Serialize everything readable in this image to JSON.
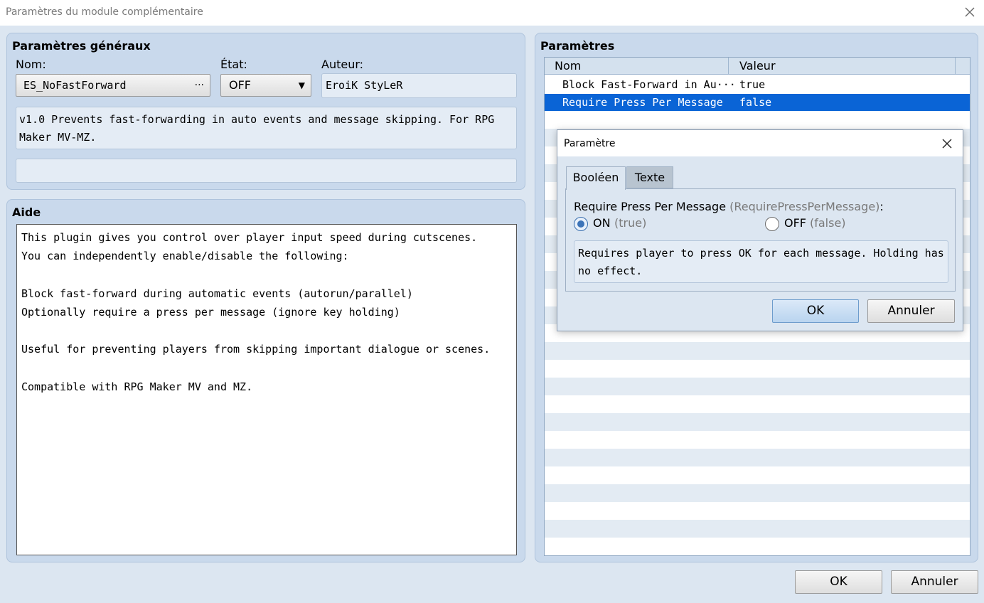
{
  "window": {
    "title": "Paramètres du module complémentaire"
  },
  "general": {
    "heading": "Paramètres généraux",
    "name_label": "Nom:",
    "name_value": "ES_NoFastForward",
    "name_button": "···",
    "state_label": "État:",
    "state_value": "OFF",
    "author_label": "Auteur:",
    "author_value": "EroiK StyLeR",
    "description_line1": "v1.0 Prevents fast-forwarding in auto events and message skipping. For RPG",
    "description_line2": "Maker MV-MZ.",
    "url_value": ""
  },
  "help": {
    "heading": "Aide",
    "lines": [
      "This plugin gives you control over player input speed during cutscenes.",
      "You can independently enable/disable the following:",
      "",
      "Block fast-forward during automatic events (autorun/parallel)",
      "Optionally require a press per message (ignore key holding)",
      "",
      "Useful for preventing players from skipping important dialogue or scenes.",
      "",
      "Compatible with RPG Maker MV and MZ."
    ]
  },
  "params": {
    "heading": "Paramètres",
    "col_name": "Nom",
    "col_value": "Valeur",
    "rows": [
      {
        "name": "Block Fast-Forward in Au···",
        "value": "true",
        "selected": false
      },
      {
        "name": "Require Press Per Message",
        "value": "false",
        "selected": true
      }
    ]
  },
  "dialog": {
    "title": "Paramètre",
    "tabs": [
      "Booléen",
      "Texte"
    ],
    "active_tab": "Booléen",
    "param_label": "Require Press Per Message",
    "param_key": "(RequirePressPerMessage)",
    "param_colon": ":",
    "on_label": "ON",
    "on_hint": "(true)",
    "off_label": "OFF",
    "off_hint": "(false)",
    "selected_option": "ON",
    "description_line1": "Requires player to press OK for each message. Holding has",
    "description_line2": "no effect.",
    "ok_label": "OK",
    "cancel_label": "Annuler"
  },
  "footer": {
    "ok_label": "OK",
    "cancel_label": "Annuler"
  },
  "colors": {
    "selection": "#0a64d6",
    "panel": "#c9d9ec",
    "background": "#dce6f1"
  }
}
